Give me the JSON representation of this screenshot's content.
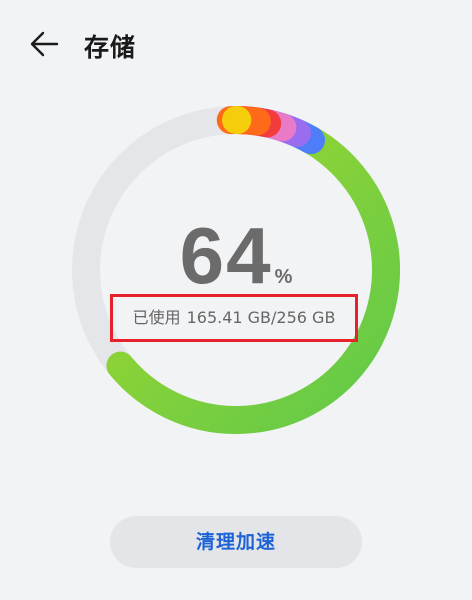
{
  "header": {
    "title": "存储",
    "back_icon": "back-arrow-icon"
  },
  "storage": {
    "percent": "64",
    "percent_unit": "%",
    "used_fraction": 0.64,
    "usage_label": "已使用",
    "usage_value": "165.41 GB/256 GB",
    "segments": [
      {
        "name": "yellow",
        "color": "#f5cd0a"
      },
      {
        "name": "orange",
        "color": "#ff6a1a"
      },
      {
        "name": "red",
        "color": "#f23c3c"
      },
      {
        "name": "pink",
        "color": "#e87ac8"
      },
      {
        "name": "purple",
        "color": "#9a6df0"
      },
      {
        "name": "blue",
        "color": "#4d7ef7"
      },
      {
        "name": "green",
        "color": "#8fd22e"
      }
    ],
    "track_color": "#e4e6e9"
  },
  "actions": {
    "clean_label": "清理加速"
  }
}
